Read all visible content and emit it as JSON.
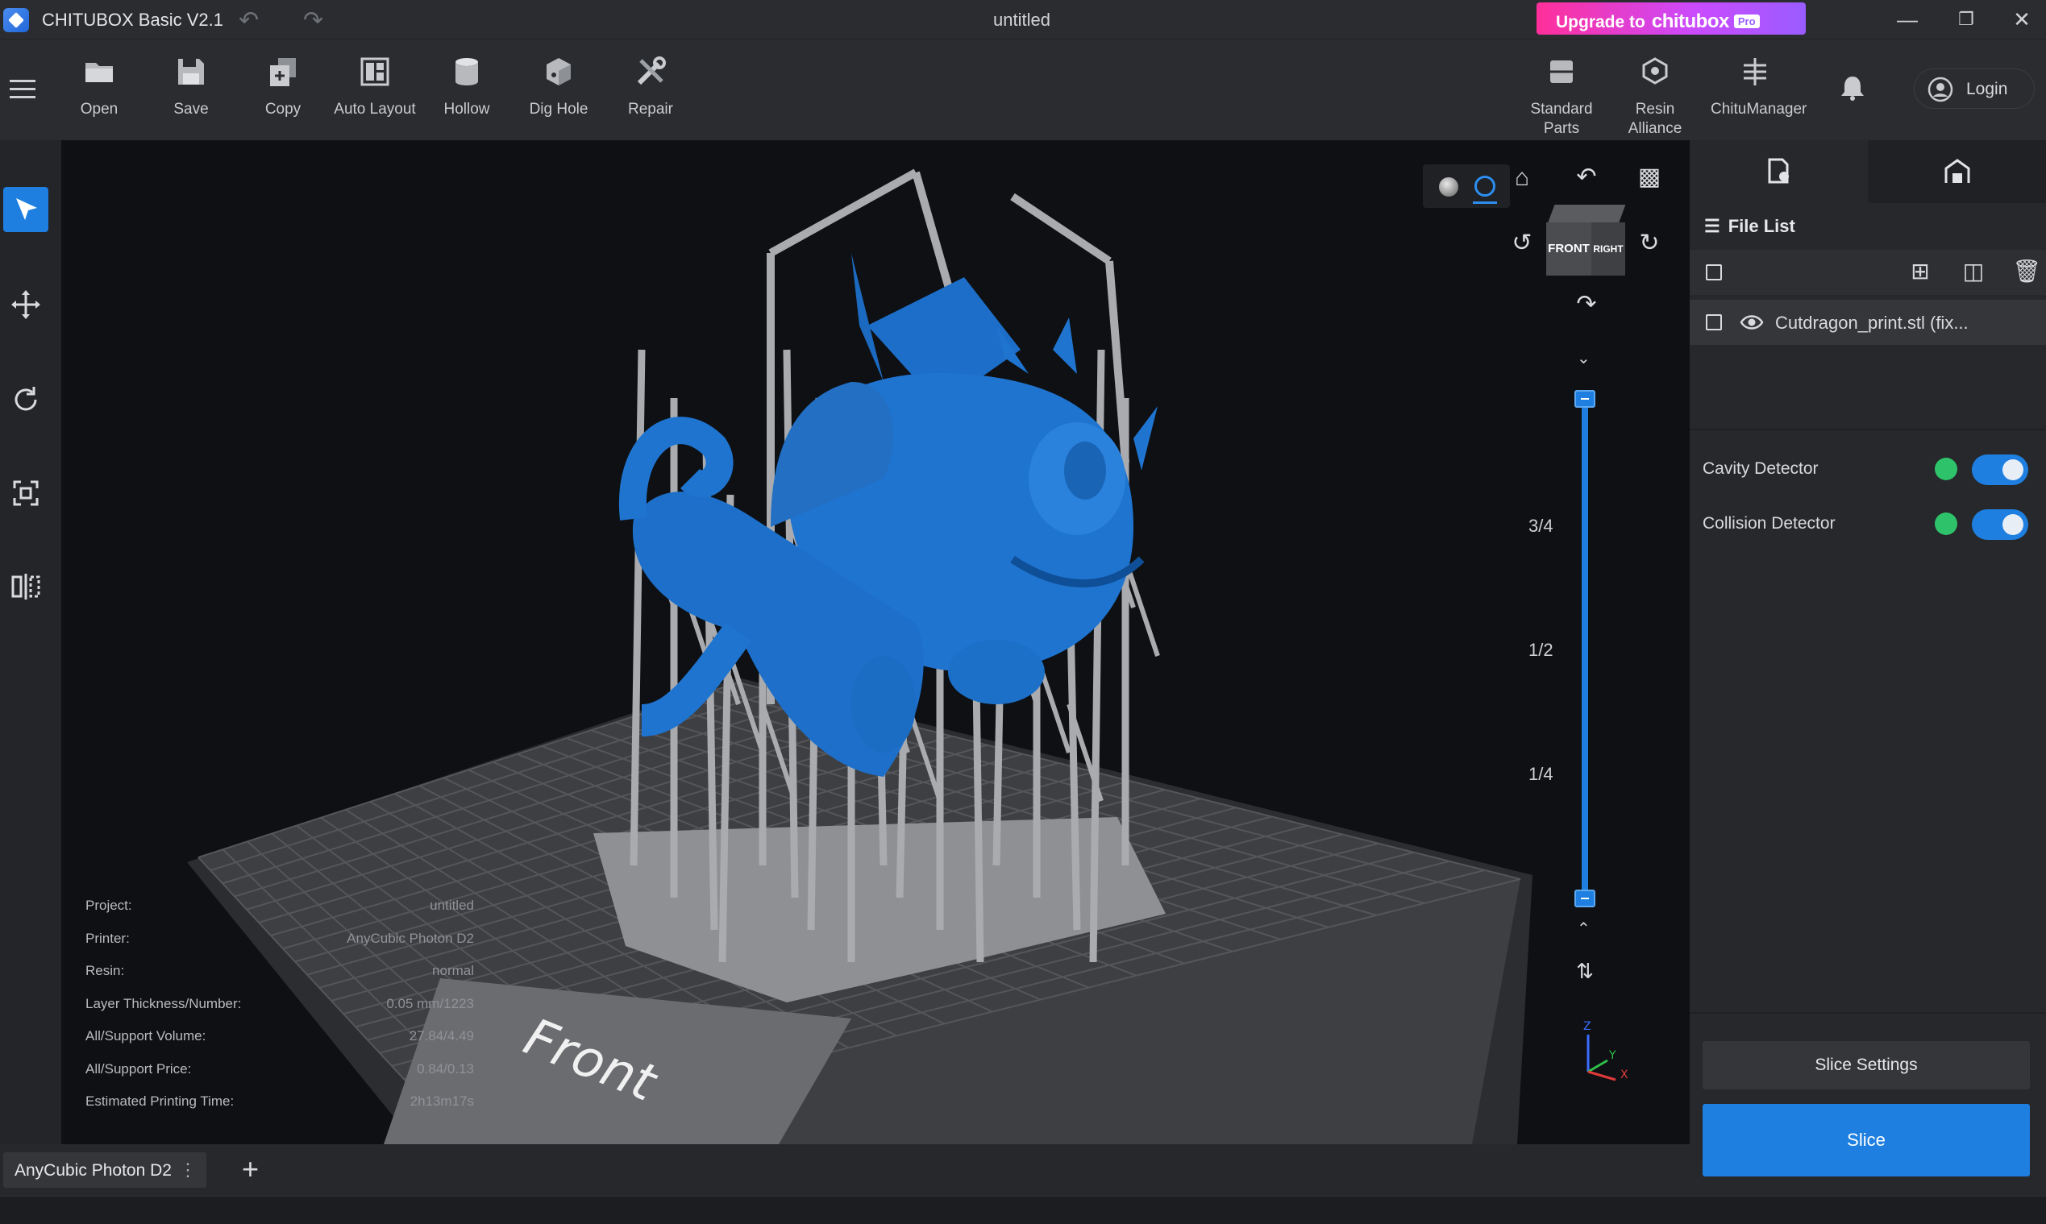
{
  "window": {
    "app_title": "CHITUBOX Basic V2.1",
    "doc_title": "untitled",
    "upgrade_prefix": "Upgrade to",
    "upgrade_brand": "chitubox",
    "upgrade_pro": "Pro"
  },
  "toolbar": {
    "tools": [
      {
        "label": "Open",
        "icon": "folder-icon"
      },
      {
        "label": "Save",
        "icon": "save-icon"
      },
      {
        "label": "Copy",
        "icon": "copy-icon"
      },
      {
        "label": "Auto Layout",
        "icon": "auto-layout-icon"
      },
      {
        "label": "Hollow",
        "icon": "hollow-icon"
      },
      {
        "label": "Dig Hole",
        "icon": "dig-hole-icon"
      },
      {
        "label": "Repair",
        "icon": "repair-icon"
      }
    ],
    "right_tools": [
      {
        "label": "Standard\nParts",
        "icon": "standard-parts-icon"
      },
      {
        "label": "Resin\nAlliance",
        "icon": "resin-alliance-icon"
      },
      {
        "label": "ChituManager",
        "icon": "chitumanager-icon"
      }
    ],
    "login": "Login"
  },
  "viewport": {
    "viewcube": {
      "front": "FRONT",
      "right": "RIGHT"
    },
    "slider_ticks": [
      "3/4",
      "1/2",
      "1/4"
    ],
    "plate_label": "Front",
    "axes": {
      "z": "Z",
      "y": "Y",
      "x": "X"
    },
    "info": [
      {
        "key": "Project:",
        "value": "untitled"
      },
      {
        "key": "Printer:",
        "value": "AnyCubic Photon D2"
      },
      {
        "key": "Resin:",
        "value": "normal"
      },
      {
        "key": "Layer Thickness/Number:",
        "value": "0.05 mm/1223"
      },
      {
        "key": "All/Support Volume:",
        "value": "27.84/4.49"
      },
      {
        "key": "All/Support Price:",
        "value": "0.84/0.13"
      },
      {
        "key": "Estimated Printing Time:",
        "value": "2h13m17s"
      }
    ]
  },
  "right_panel": {
    "file_list_title": "File List",
    "files": [
      {
        "name": "Cutdragon_print.stl (fix..."
      }
    ],
    "detectors": [
      {
        "name": "Cavity Detector",
        "enabled": true
      },
      {
        "name": "Collision Detector",
        "enabled": true
      }
    ],
    "slice_settings": "Slice Settings",
    "slice": "Slice"
  },
  "bottom": {
    "printer_tab": "AnyCubic Photon D2",
    "add": "+"
  },
  "colors": {
    "accent": "#1e7fe0",
    "model": "#1f74d0",
    "support": "#a9abaf",
    "status_ok": "#2ec36a"
  }
}
